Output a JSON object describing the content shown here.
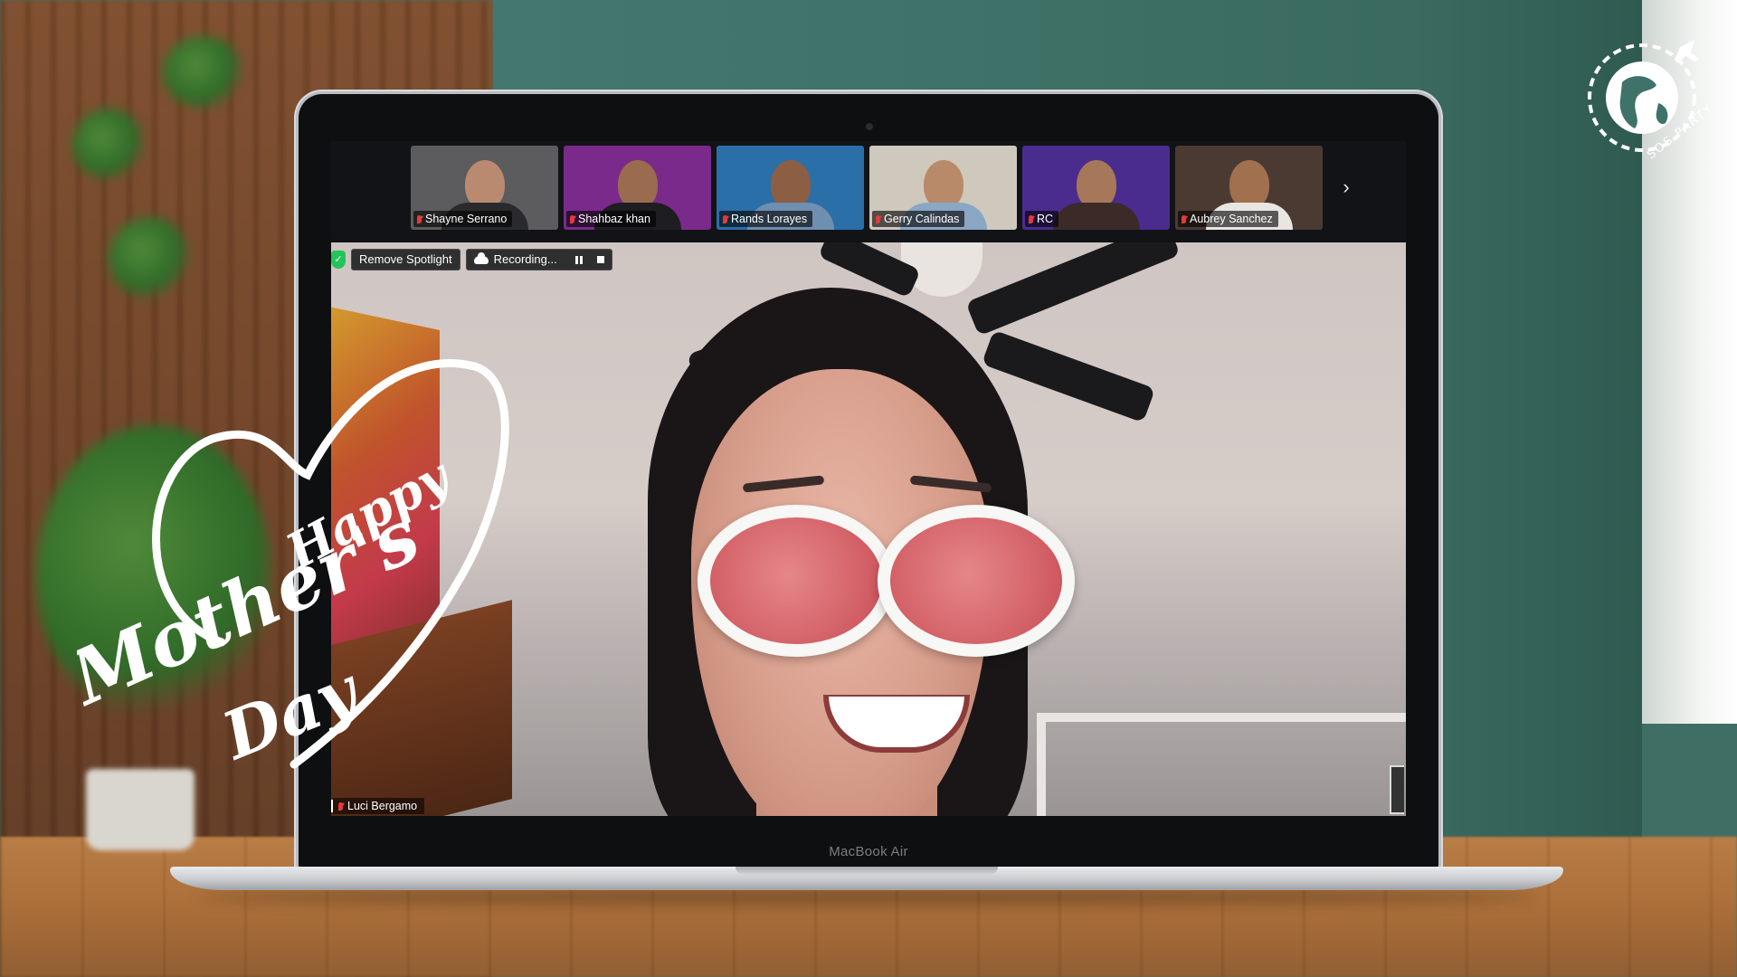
{
  "participants": [
    {
      "name": "Shayne Serrano",
      "bg": "#5c5b5e",
      "face": "#b98a70",
      "body": "#2a2a2e"
    },
    {
      "name": "Shahbaz khan",
      "bg": "#7a2a8a",
      "face": "#9b6b4f",
      "body": "#1d1d22"
    },
    {
      "name": "Rands Lorayes",
      "bg": "#2b6fa8",
      "face": "#8c5e44",
      "body": "#6f8fb0"
    },
    {
      "name": "Gerry Calindas",
      "bg": "#cfc8bd",
      "face": "#b88a6a",
      "body": "#8aa7c4"
    },
    {
      "name": "RC",
      "bg": "#4a2c8e",
      "face": "#a7775a",
      "body": "#3b2a28"
    },
    {
      "name": "Aubrey Sanchez",
      "bg": "#4b3a32",
      "face": "#a0704f",
      "body": "#e9e6e2"
    }
  ],
  "controls": {
    "shield_glyph": "✓",
    "remove_spotlight": "Remove Spotlight",
    "recording": "Recording..."
  },
  "spotlight": {
    "name": "Luci Bergamo"
  },
  "laptop": {
    "model_label": "MacBook Air"
  },
  "overlay": {
    "greeting_line1": "Happy",
    "greeting_line2": "Mother's",
    "greeting_line3": "Day",
    "logo_text": "SOS PARTY"
  },
  "icons": [
    "shield-icon",
    "cloud-icon",
    "pause-icon",
    "stop-icon",
    "mic-muted-icon",
    "chevron-right-icon",
    "globe-icon",
    "airplane-icon",
    "heart-icon"
  ],
  "colors": {
    "wall_green": "#3f7268",
    "recording_shield": "#23c45a",
    "muted_mic": "#e23b3b"
  }
}
